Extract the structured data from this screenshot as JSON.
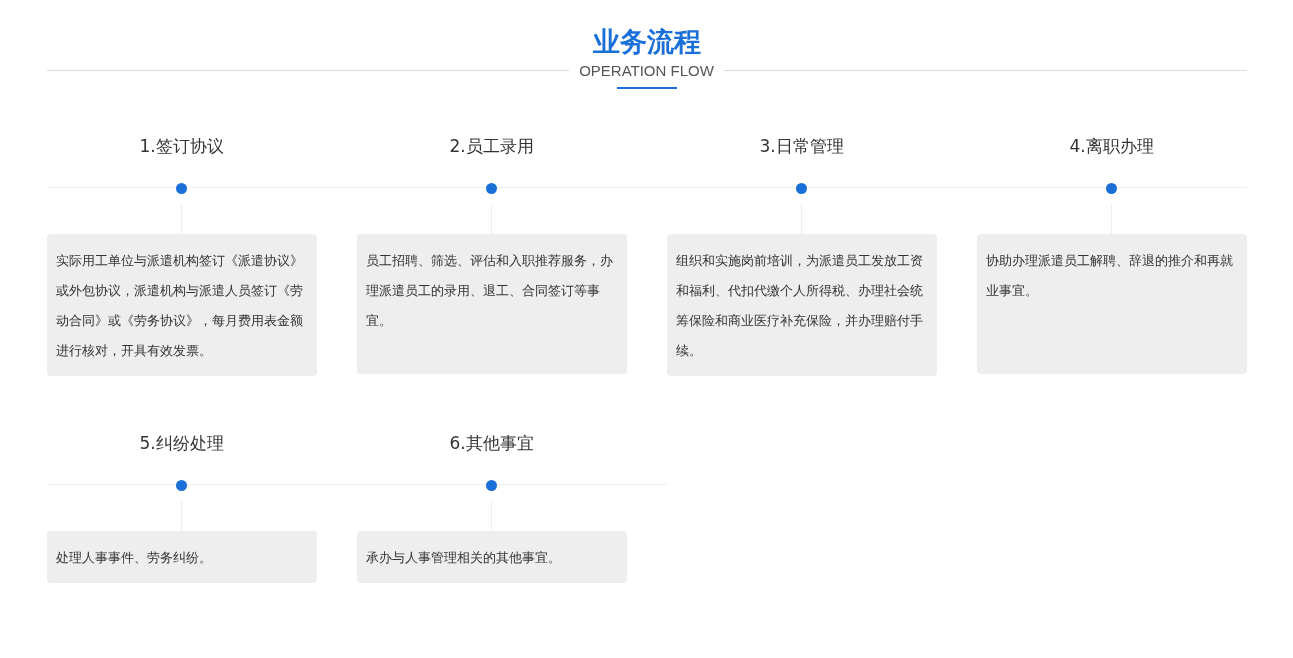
{
  "header": {
    "title": "业务流程",
    "subtitle": "OPERATION FLOW"
  },
  "steps": [
    {
      "title": "1.签订协议",
      "description": "实际用工单位与派遣机构签订《派遣协议》或外包协议，派遣机构与派遣人员签订《劳动合同》或《劳务协议》，每月费用表金额进行核对，开具有效发票。"
    },
    {
      "title": "2.员工录用",
      "description": "员工招聘、筛选、评估和入职推荐服务，办理派遣员工的录用、退工、合同签订等事宜。"
    },
    {
      "title": "3.日常管理",
      "description": "组织和实施岗前培训，为派遣员工发放工资和福利、代扣代缴个人所得税、办理社会统筹保险和商业医疗补充保险，并办理赔付手续。"
    },
    {
      "title": "4.离职办理",
      "description": "协助办理派遣员工解聘、辞退的推介和再就业事宜。"
    },
    {
      "title": "5.纠纷处理",
      "description": "处理人事事件、劳务纠纷。"
    },
    {
      "title": "6.其他事宜",
      "description": "承办与人事管理相关的其他事宜。"
    }
  ]
}
